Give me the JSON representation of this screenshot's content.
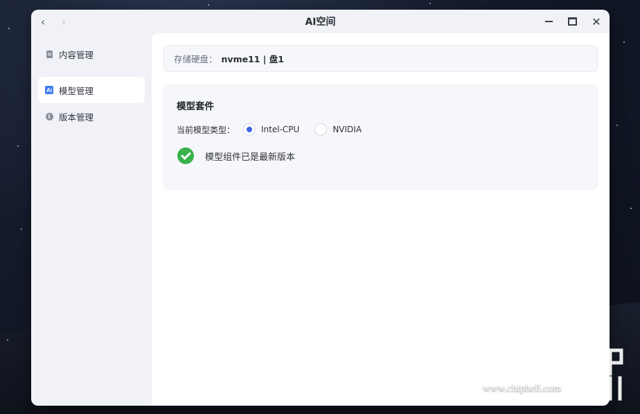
{
  "window": {
    "title": "AI空间"
  },
  "sidebar": {
    "items": [
      {
        "label": "内容管理",
        "icon": "document-icon",
        "active": false
      },
      {
        "label": "模型管理",
        "icon": "ai-icon",
        "active": true
      },
      {
        "label": "版本管理",
        "icon": "info-icon",
        "active": false
      }
    ]
  },
  "storage": {
    "label": "存储硬盘：",
    "value": "nvme11 | 盘1"
  },
  "model_suite": {
    "title": "模型套件",
    "type_label": "当前模型类型：",
    "options": [
      {
        "label": "Intel-CPU",
        "selected": true
      },
      {
        "label": "NVIDIA",
        "selected": false
      }
    ],
    "status_text": "模型组件已是最新版本"
  },
  "watermark": {
    "text": "www.chiphell.com"
  },
  "colors": {
    "accent": "#3e63e6",
    "success": "#37b34a",
    "ai_icon": "#3d7cf0"
  }
}
